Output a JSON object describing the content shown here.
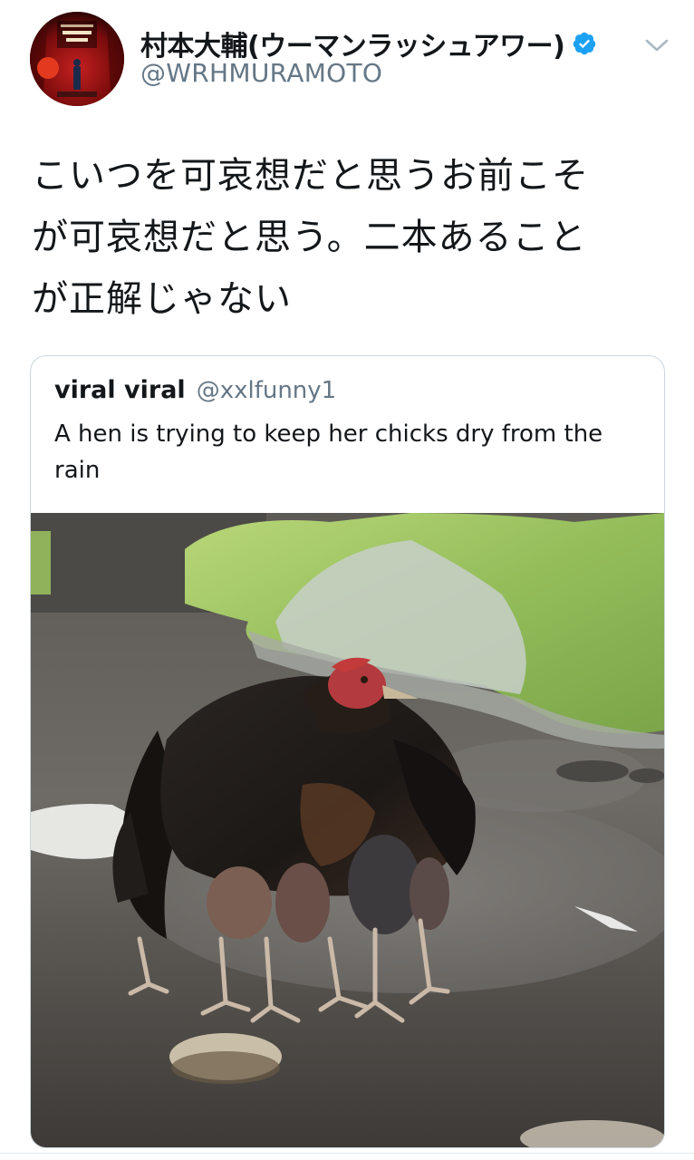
{
  "tweet": {
    "author": {
      "display_name": "村本大輔(ウーマンラッシュアワー)",
      "handle": "@WRHMURAMOTO",
      "verified": true,
      "avatar_icon": "profile-photo-stage-performer"
    },
    "text_lines": [
      "こいつを可哀想だと思うお前こそ",
      "が可哀想だと思う。二本あること",
      "が正解じゃない"
    ],
    "menu_icon": "chevron-down-icon"
  },
  "quoted_tweet": {
    "display_name": "viral viral",
    "handle": "@xxlfunny1",
    "text": "A hen is trying to keep her chicks dry from the rain",
    "media_icon": "photo-hen-sheltering-chicks"
  },
  "colors": {
    "text_primary": "#14171a",
    "text_secondary": "#657786",
    "verified_blue": "#1da1f2",
    "card_border": "#ccd6dd"
  }
}
